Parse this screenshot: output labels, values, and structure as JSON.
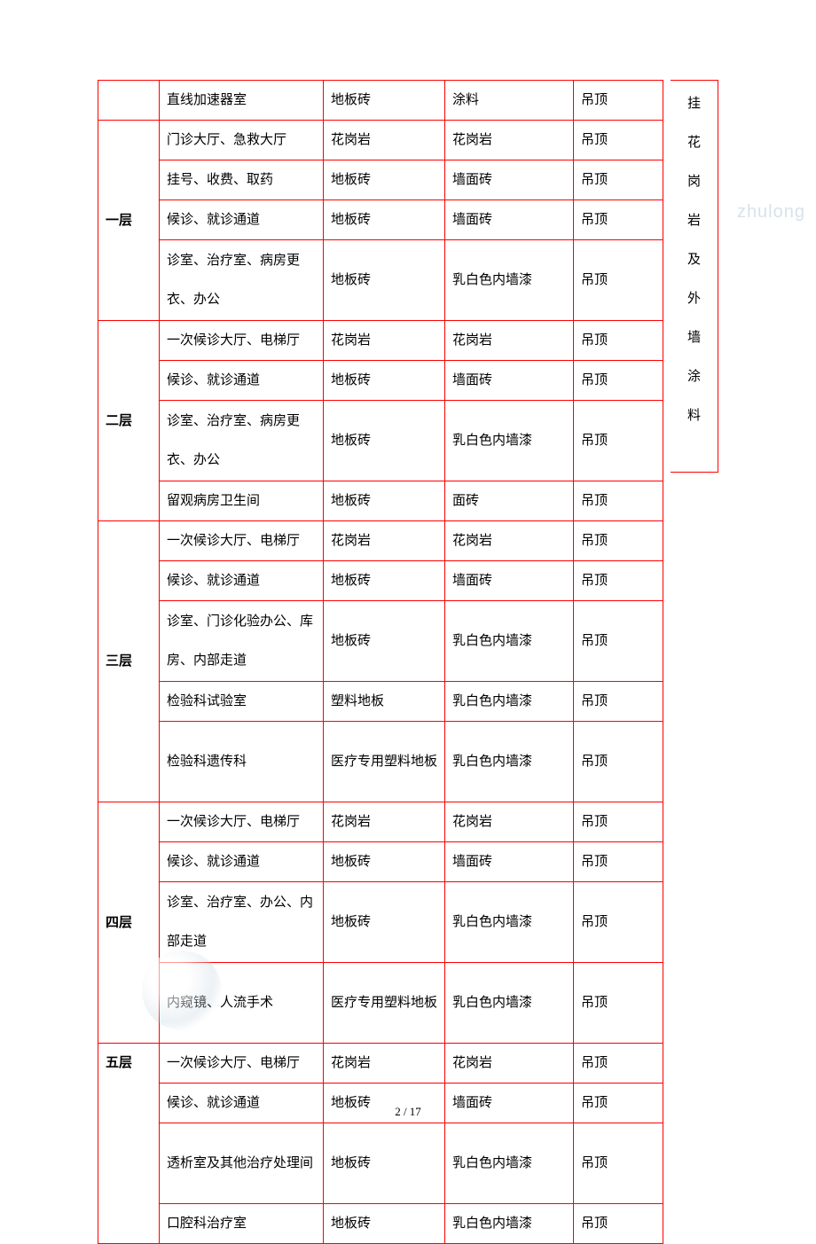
{
  "pageNumber": "2 / 17",
  "watermark": "zhulong",
  "sideColumn": [
    "挂",
    "花",
    "岗",
    "岩",
    "及",
    "外",
    "墙",
    "涂",
    "料"
  ],
  "rows": [
    {
      "g": "",
      "a": "直线加速器室",
      "b": "地板砖",
      "c": "涂料",
      "d": "吊顶",
      "gspan": 1
    },
    {
      "g": "一层",
      "a": "门诊大厅、急救大厅",
      "b": "花岗岩",
      "c": "花岗岩",
      "d": "吊顶",
      "gspan": 4
    },
    {
      "a": "挂号、收费、取药",
      "b": "地板砖",
      "c": "墙面砖",
      "d": "吊顶"
    },
    {
      "a": "候诊、就诊通道",
      "b": "地板砖",
      "c": "墙面砖",
      "d": "吊顶"
    },
    {
      "a": "诊室、治疗室、病房更衣、办公",
      "b": "地板砖",
      "c": "乳白色内墙漆",
      "d": "吊顶",
      "dbl": true
    },
    {
      "g": "二层",
      "a": "一次候诊大厅、电梯厅",
      "b": "花岗岩",
      "c": "花岗岩",
      "d": "吊顶",
      "gspan": 4
    },
    {
      "a": "候诊、就诊通道",
      "b": "地板砖",
      "c": "墙面砖",
      "d": "吊顶"
    },
    {
      "a": "诊室、治疗室、病房更衣、办公",
      "b": "地板砖",
      "c": "乳白色内墙漆",
      "d": "吊顶",
      "dbl": true
    },
    {
      "a": "留观病房卫生间",
      "b": "地板砖",
      "c": "面砖",
      "d": "吊顶"
    },
    {
      "g": "三层",
      "a": "一次候诊大厅、电梯厅",
      "b": "花岗岩",
      "c": "花岗岩",
      "d": "吊顶",
      "gspan": 5
    },
    {
      "a": "候诊、就诊通道",
      "b": "地板砖",
      "c": "墙面砖",
      "d": "吊顶"
    },
    {
      "a": "诊室、门诊化验办公、库房、内部走道",
      "b": "地板砖",
      "c": "乳白色内墙漆",
      "d": "吊顶",
      "dbl": true
    },
    {
      "a": "检验科试验室",
      "b": "塑料地板",
      "c": "乳白色内墙漆",
      "d": "吊顶"
    },
    {
      "a": "检验科遗传科",
      "b": "医疗专用塑料地板",
      "c": "乳白色内墙漆",
      "d": "吊顶",
      "dbl": true
    },
    {
      "g": "四层",
      "a": "一次候诊大厅、电梯厅",
      "b": "花岗岩",
      "c": "花岗岩",
      "d": "吊顶",
      "gspan": 4
    },
    {
      "a": "候诊、就诊通道",
      "b": "地板砖",
      "c": "墙面砖",
      "d": "吊顶"
    },
    {
      "a": "诊室、治疗室、办公、内部走道",
      "b": "地板砖",
      "c": "乳白色内墙漆",
      "d": "吊顶",
      "dbl": true
    },
    {
      "a": "内窥镜、人流手术",
      "b": "医疗专用塑料地板",
      "c": "乳白色内墙漆",
      "d": "吊顶",
      "dbl": true
    },
    {
      "g": "五层",
      "a": "一次候诊大厅、电梯厅",
      "b": "花岗岩",
      "c": "花岗岩",
      "d": "吊顶",
      "gspan": 4,
      "gtop": true
    },
    {
      "a": "候诊、就诊通道",
      "b": "地板砖",
      "c": "墙面砖",
      "d": "吊顶"
    },
    {
      "a": "透析室及其他治疗处理间",
      "b": "地板砖",
      "c": "乳白色内墙漆",
      "d": "吊顶",
      "dbl": true
    },
    {
      "a": "口腔科治疗室",
      "b": "地板砖",
      "c": "乳白色内墙漆",
      "d": "吊顶"
    }
  ]
}
